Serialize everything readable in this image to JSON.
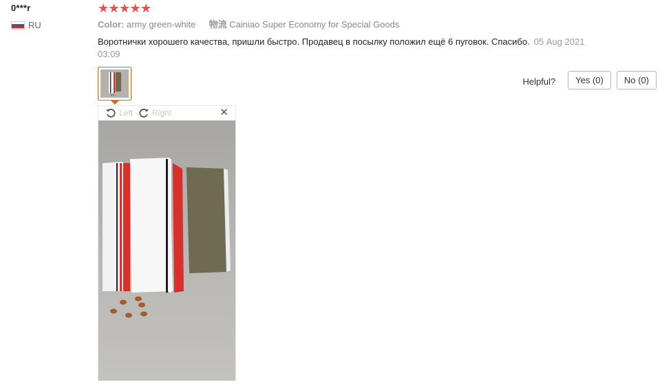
{
  "reviewer": {
    "name": "0***r",
    "country_code": "RU"
  },
  "rating": {
    "stars": 5,
    "max": 5,
    "star_color": "#e8504b"
  },
  "attributes": {
    "color_label": "Color:",
    "color_value": "army green-white",
    "shipping_label": "物流",
    "shipping_value": "Cainiao Super Economy for Special Goods"
  },
  "feedback": {
    "text": "Воротнички хорошего качества, пришли быстро. Продавец в посылку положил ещё 6 пуговок. Спасибо.",
    "date": "05 Aug 2021 03:09"
  },
  "helpful": {
    "label": "Helpful?",
    "yes_label": "Yes (0)",
    "no_label": "No (0)"
  },
  "viewer": {
    "rotate_left": "Left",
    "rotate_right": "Right",
    "close_symbol": "✕"
  },
  "colors": {
    "accent": "#e26818",
    "star": "#e8504b"
  }
}
